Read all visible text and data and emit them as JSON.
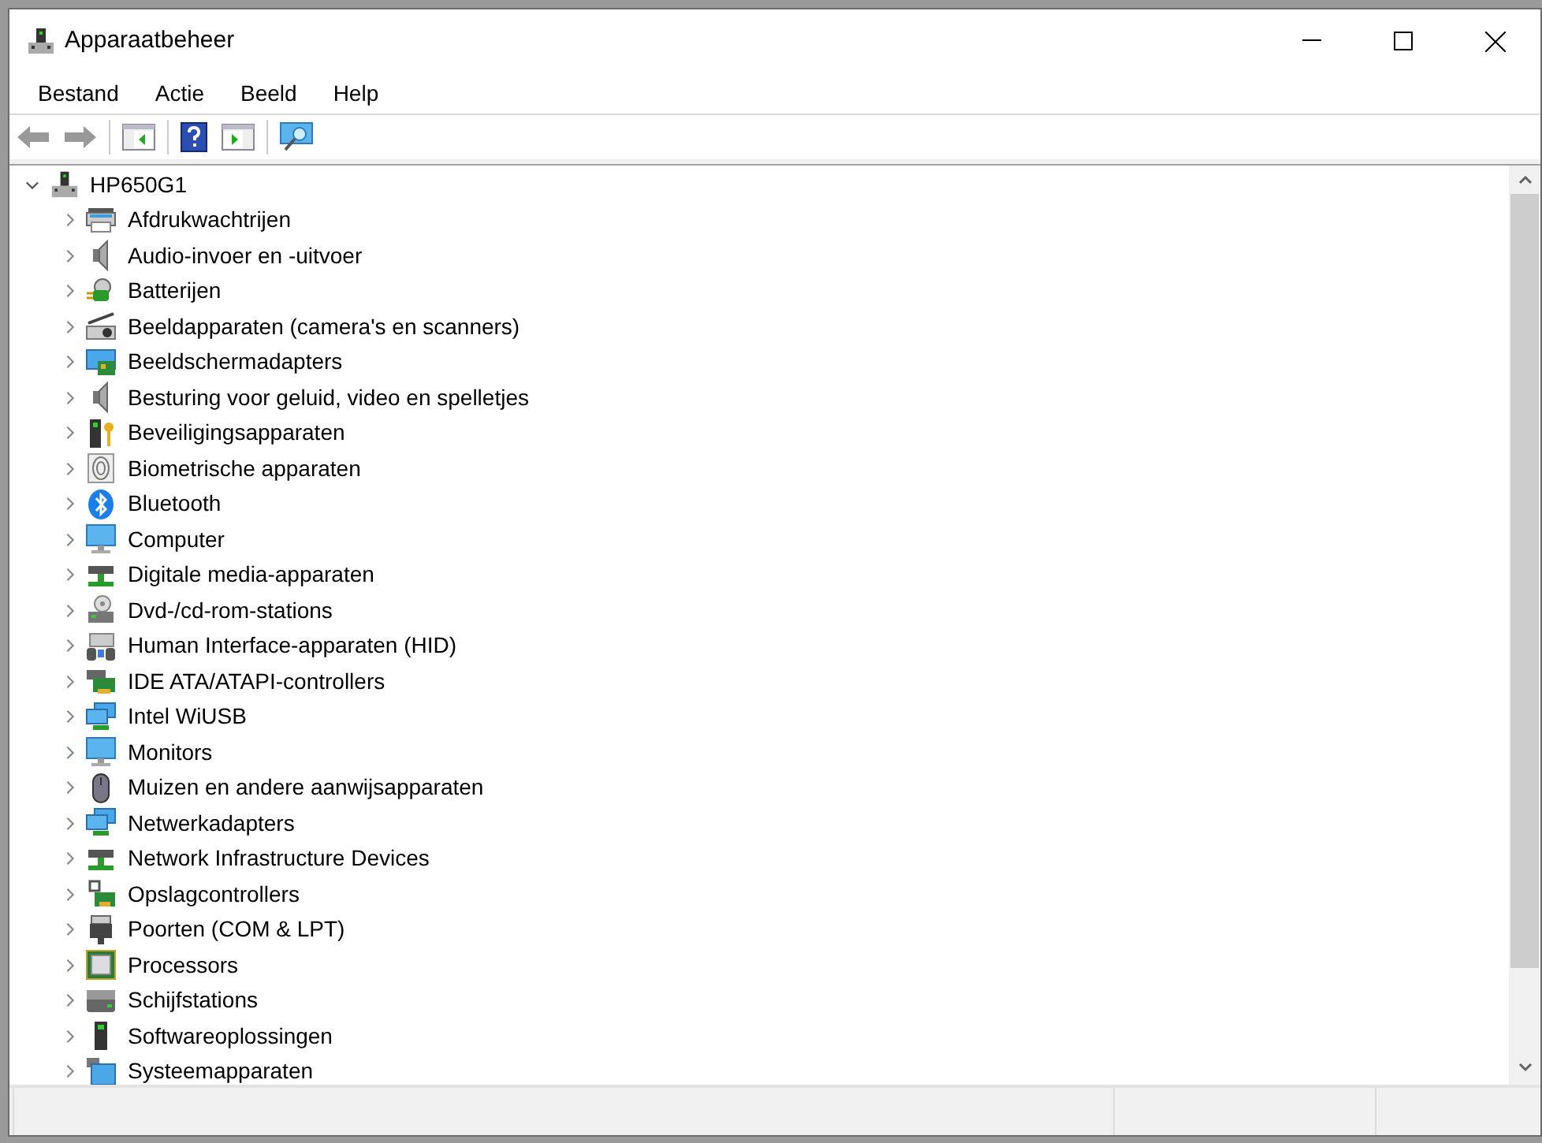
{
  "window": {
    "title": "Apparaatbeheer"
  },
  "menu": [
    "Bestand",
    "Actie",
    "Beeld",
    "Help"
  ],
  "tree": {
    "label": "HP650G1",
    "expanded": true,
    "children": [
      {
        "label": "Afdrukwachtrijen",
        "expanded": false
      },
      {
        "label": "Audio-invoer en -uitvoer",
        "expanded": false
      },
      {
        "label": "Batterijen",
        "expanded": false
      },
      {
        "label": "Beeldapparaten (camera's en scanners)",
        "expanded": false
      },
      {
        "label": "Beeldschermadapters",
        "expanded": false
      },
      {
        "label": "Besturing voor geluid, video en spelletjes",
        "expanded": false
      },
      {
        "label": "Beveiligingsapparaten",
        "expanded": false
      },
      {
        "label": "Biometrische apparaten",
        "expanded": false
      },
      {
        "label": "Bluetooth",
        "expanded": false
      },
      {
        "label": "Computer",
        "expanded": false
      },
      {
        "label": "Digitale media-apparaten",
        "expanded": false
      },
      {
        "label": "Dvd-/cd-rom-stations",
        "expanded": false
      },
      {
        "label": "Human Interface-apparaten (HID)",
        "expanded": false
      },
      {
        "label": "IDE ATA/ATAPI-controllers",
        "expanded": false
      },
      {
        "label": "Intel WiUSB",
        "expanded": false
      },
      {
        "label": "Monitors",
        "expanded": false
      },
      {
        "label": "Muizen en andere aanwijsapparaten",
        "expanded": false
      },
      {
        "label": "Netwerkadapters",
        "expanded": false
      },
      {
        "label": "Network Infrastructure Devices",
        "expanded": false
      },
      {
        "label": "Opslagcontrollers",
        "expanded": false
      },
      {
        "label": "Poorten (COM & LPT)",
        "expanded": false
      },
      {
        "label": "Processors",
        "expanded": false
      },
      {
        "label": "Schijfstations",
        "expanded": false
      },
      {
        "label": "Softwareoplossingen",
        "expanded": false
      },
      {
        "label": "Systeemapparaten",
        "expanded": false
      }
    ]
  }
}
